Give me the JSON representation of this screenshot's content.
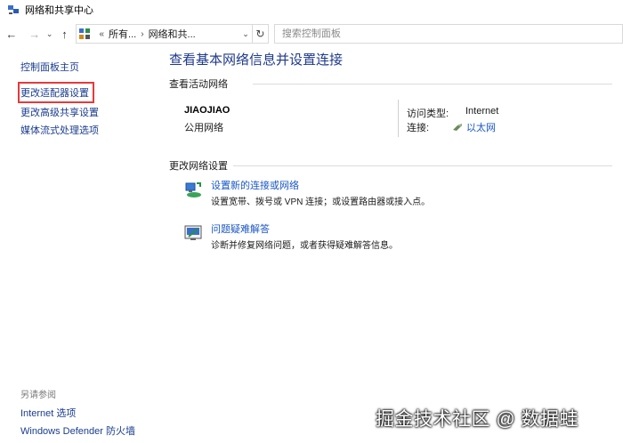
{
  "window": {
    "title": "网络和共享中心"
  },
  "address": {
    "crumbs": [
      "所有...",
      "网络和共..."
    ],
    "search_placeholder": "搜索控制面板"
  },
  "sidebar": {
    "items": [
      {
        "label": "控制面板主页"
      },
      {
        "label": "更改适配器设置",
        "highlighted": true
      },
      {
        "label": "更改高级共享设置"
      },
      {
        "label": "媒体流式处理选项"
      }
    ],
    "see_also_heading": "另请参阅",
    "see_also": [
      {
        "label": "Internet 选项"
      },
      {
        "label": "Windows Defender 防火墙"
      }
    ]
  },
  "main": {
    "title": "查看基本网络信息并设置连接",
    "active_heading": "查看活动网络",
    "network": {
      "name": "JIAOJIAO",
      "type": "公用网络",
      "access_label": "访问类型:",
      "access_value": "Internet",
      "conn_label": "连接:",
      "conn_value": "以太网"
    },
    "change_heading": "更改网络设置",
    "tasks": [
      {
        "title": "设置新的连接或网络",
        "desc": "设置宽带、拨号或 VPN 连接；或设置路由器或接入点。",
        "icon": "new-connection-icon"
      },
      {
        "title": "问题疑难解答",
        "desc": "诊断并修复网络问题，或者获得疑难解答信息。",
        "icon": "troubleshoot-icon"
      }
    ]
  },
  "watermark": "掘金技术社区 @ 数据蛙",
  "colors": {
    "link": "#1a57c6",
    "title": "#1e3a8a",
    "highlight_border": "#e53a3a"
  }
}
